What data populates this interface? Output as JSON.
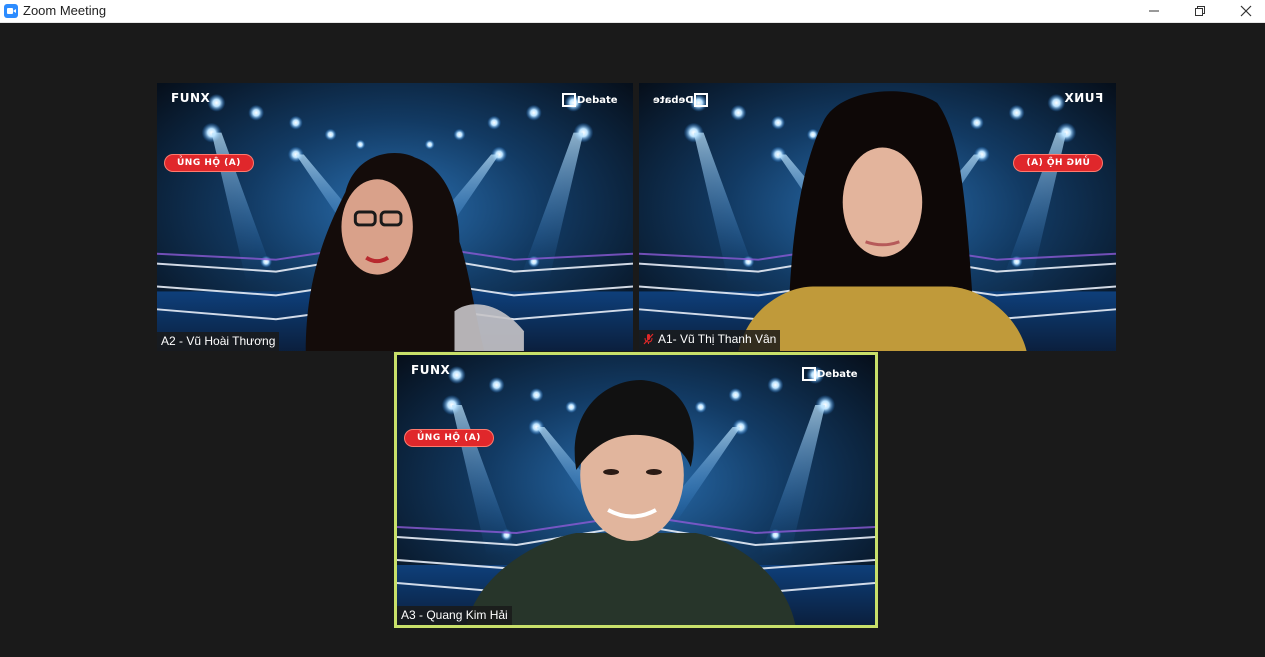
{
  "window": {
    "title": "Zoom Meeting",
    "controls": {
      "minimize": "minimize-icon",
      "restore": "restore-icon",
      "close": "close-icon"
    }
  },
  "colors": {
    "background": "#1a1a1a",
    "active_speaker_border": "#c8e06a",
    "badge": "#e0272b",
    "stage_blue": "#1e78d4"
  },
  "tiles": [
    {
      "name": "A2 - Vũ Hoài Thương",
      "muted": false,
      "badge": "ỦNG HỘ (A)",
      "logo_left": "FUNX",
      "logo_right": "Debate"
    },
    {
      "name": "A1- Vũ Thị Thanh Vân",
      "muted": true,
      "badge": "ỦNG HỘ (A)",
      "logo_left": "FUNX",
      "logo_right": "Debate",
      "mirrored": true
    },
    {
      "name": "A3 - Quang Kim Hải",
      "muted": false,
      "active_speaker": true,
      "badge": "ỦNG HỘ (A)",
      "logo_left": "FUNX",
      "logo_right": "Debate"
    }
  ]
}
